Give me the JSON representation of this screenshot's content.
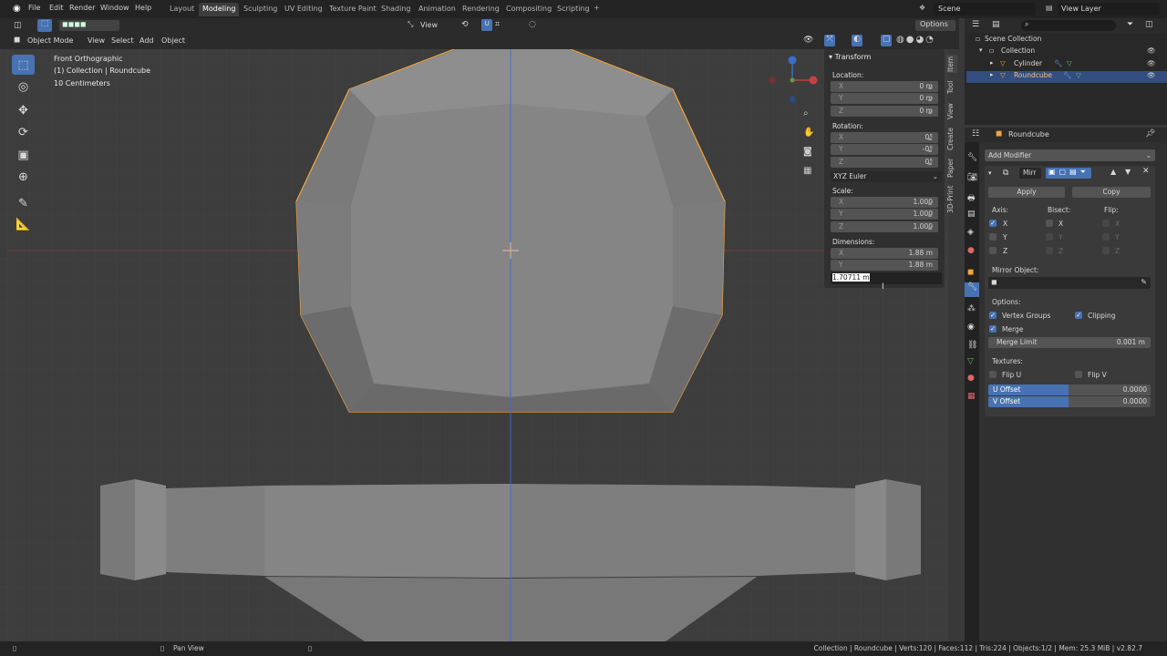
{
  "menu": [
    "File",
    "Edit",
    "Render",
    "Window",
    "Help"
  ],
  "workspaces": [
    "Layout",
    "Modeling",
    "Sculpting",
    "UV Editing",
    "Texture Paint",
    "Shading",
    "Animation",
    "Rendering",
    "Compositing",
    "Scripting"
  ],
  "active_workspace": "Modeling",
  "scene": {
    "name": "Scene",
    "view_layer": "View Layer"
  },
  "viewport_header": {
    "view_label": "View",
    "options_label": "Options"
  },
  "viewport_menu": {
    "mode": "Object Mode",
    "items": [
      "View",
      "Select",
      "Add",
      "Object"
    ]
  },
  "overlay": {
    "view_name": "Front Orthographic",
    "collection_info": "(1) Collection | Roundcube",
    "scale_info": "10 Centimeters"
  },
  "npanel": {
    "title": "Transform",
    "location_label": "Location:",
    "location": [
      {
        "axis": "X",
        "value": "0 m"
      },
      {
        "axis": "Y",
        "value": "0 m"
      },
      {
        "axis": "Z",
        "value": "0 m"
      }
    ],
    "rotation_label": "Rotation:",
    "rotation": [
      {
        "axis": "X",
        "value": "0°"
      },
      {
        "axis": "Y",
        "value": "-0°"
      },
      {
        "axis": "Z",
        "value": "0°"
      }
    ],
    "rotation_mode": "XYZ Euler",
    "scale_label": "Scale:",
    "scale": [
      {
        "axis": "X",
        "value": "1.000"
      },
      {
        "axis": "Y",
        "value": "1.000"
      },
      {
        "axis": "Z",
        "value": "1.000"
      }
    ],
    "dimensions_label": "Dimensions:",
    "dimensions": [
      {
        "axis": "X",
        "value": "1.88 m"
      },
      {
        "axis": "Y",
        "value": "1.88 m"
      }
    ],
    "editing_value": "1.70711 m",
    "tabs": [
      "Item",
      "Tool",
      "View",
      "Create",
      "Paper",
      "3D-Print"
    ]
  },
  "outliner": {
    "root": "Scene Collection",
    "items": [
      {
        "name": "Collection"
      },
      {
        "name": "Cylinder"
      },
      {
        "name": "Roundcube"
      }
    ]
  },
  "properties": {
    "object_name": "Roundcube",
    "add_modifier": "Add Modifier",
    "modifier_name": "Mirr",
    "apply_label": "Apply",
    "copy_label": "Copy",
    "axis_label": "Axis:",
    "bisect_label": "Bisect:",
    "flip_label": "Flip:",
    "axes": [
      "X",
      "Y",
      "Z"
    ],
    "mirror_object_label": "Mirror Object:",
    "options_label": "Options:",
    "vertex_groups_label": "Vertex Groups",
    "clipping_label": "Clipping",
    "merge_label": "Merge",
    "merge_limit_label": "Merge Limit",
    "merge_limit_value": "0.001 m",
    "textures_label": "Textures:",
    "flip_u_label": "Flip U",
    "flip_v_label": "Flip V",
    "u_offset_label": "U Offset",
    "u_offset_value": "0.0000",
    "v_offset_label": "V Offset",
    "v_offset_value": "0.0000"
  },
  "statusbar": {
    "pan_view": "Pan View",
    "stats": "Collection | Roundcube | Verts:120 | Faces:112 | Tris:224 | Objects:1/2 | Mem: 25.3 MiB | v2.82.7"
  },
  "colors": {
    "accent": "#4772b3",
    "selection": "#f2a53b",
    "x_axis": "#c24242",
    "z_axis": "#3a6ec7"
  }
}
